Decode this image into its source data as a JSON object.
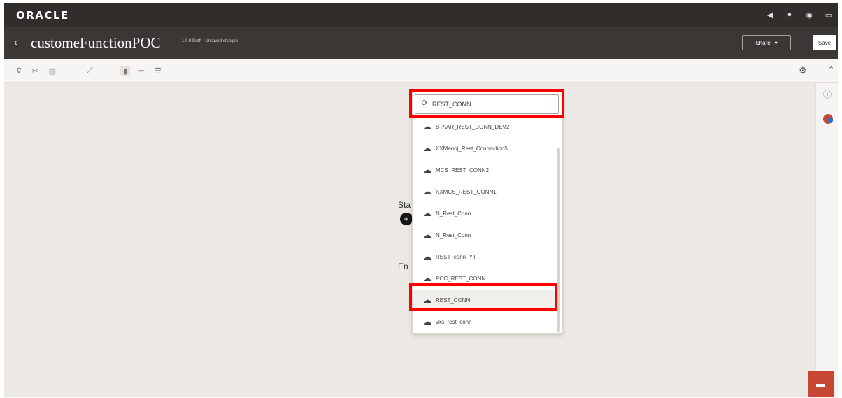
{
  "topbar": {
    "logo": "ORACLE",
    "icons": [
      "megaphone-icon",
      "bell-icon",
      "help-icon",
      "user-icon"
    ]
  },
  "titlebar": {
    "back_symbol": "‹",
    "title": "customeFunctionPOC",
    "subtitle": "1.0.0 Draft - Unsaved changes",
    "share_label": "Share",
    "save_label": "Save"
  },
  "toolbar": {
    "icons": [
      "pin-icon",
      "cut-icon",
      "paste-icon",
      "expand-icon",
      "vertical-layout-icon",
      "horizontal-layout-icon",
      "tree-layout-icon",
      "gear-icon",
      "collapse-icon"
    ]
  },
  "canvas": {
    "start_label": "Sta",
    "end_label": "En"
  },
  "dropdown": {
    "search_value": "REST_CONN",
    "items": [
      "STAAR_REST_CONN_DEV2",
      "XXManoj_Rest_Connection5",
      "MCS_REST_CONN2",
      "XXMCS_REST_CONN1",
      "N_Rest_Conn",
      "N_Rest_Conn",
      "REST_conn_YT",
      "POC_REST_CONN",
      "REST_CONN",
      "vks_rest_conn"
    ],
    "selected_index": 8
  },
  "colors": {
    "topbar": "#312d2a",
    "titlebar": "#3a3734",
    "canvas": "#ece9e4",
    "highlight": "#ff0000",
    "chat": "#c74634"
  }
}
